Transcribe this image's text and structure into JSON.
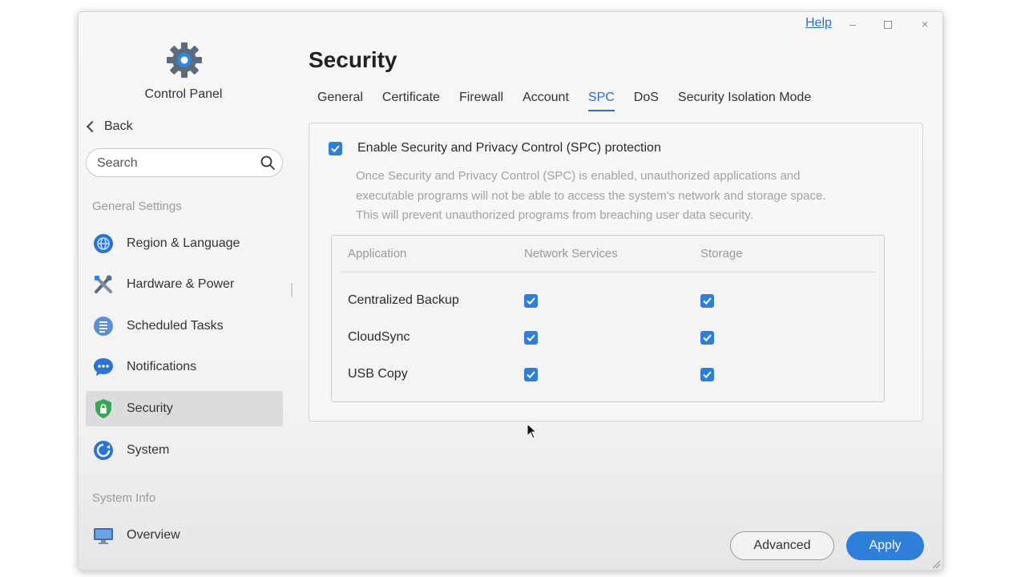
{
  "window": {
    "help": "Help",
    "minimize": "–",
    "close": "×"
  },
  "sidebar": {
    "app_title": "Control Panel",
    "back": "Back",
    "search_placeholder": "Search",
    "section_general": "General Settings",
    "section_system_info": "System Info",
    "items": [
      {
        "label": "Region & Language",
        "icon": "globe-icon"
      },
      {
        "label": "Hardware & Power",
        "icon": "tools-icon"
      },
      {
        "label": "Scheduled Tasks",
        "icon": "tasks-icon"
      },
      {
        "label": "Notifications",
        "icon": "chat-bubble-icon"
      },
      {
        "label": "Security",
        "icon": "shield-icon",
        "active": true
      },
      {
        "label": "System",
        "icon": "system-icon"
      },
      {
        "label": "Overview",
        "icon": "monitor-icon"
      }
    ]
  },
  "main": {
    "title": "Security",
    "tabs": [
      {
        "label": "General"
      },
      {
        "label": "Certificate"
      },
      {
        "label": "Firewall"
      },
      {
        "label": "Account"
      },
      {
        "label": "SPC",
        "active": true
      },
      {
        "label": "DoS"
      },
      {
        "label": "Security Isolation Mode"
      }
    ],
    "enable_label": "Enable Security and Privacy Control (SPC) protection",
    "enable_checked": true,
    "description": [
      "Once Security and Privacy Control (SPC) is enabled, unauthorized applications and",
      "executable programs will not be able to access the system's network and storage space.",
      "This will prevent unauthorized programs from breaching user data security."
    ],
    "table": {
      "headers": [
        "Application",
        "Network Services",
        "Storage"
      ],
      "rows": [
        {
          "application": "Centralized Backup",
          "network": true,
          "storage": true
        },
        {
          "application": "CloudSync",
          "network": true,
          "storage": true
        },
        {
          "application": "USB Copy",
          "network": true,
          "storage": true
        }
      ]
    }
  },
  "footer": {
    "advanced": "Advanced",
    "apply": "Apply"
  },
  "colors": {
    "accent": "#2e7fd9",
    "link": "#2c6fc4",
    "active_nav_bg": "#dcdcde"
  }
}
